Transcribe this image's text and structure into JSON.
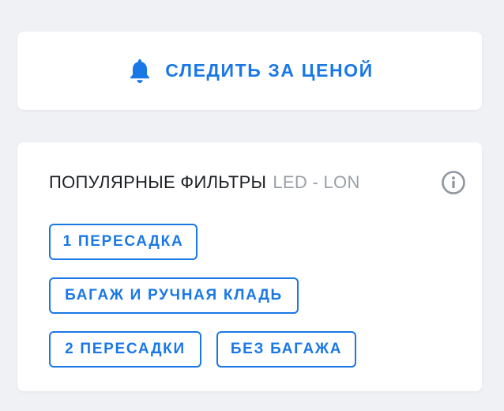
{
  "watch_price": {
    "label": "СЛЕДИТЬ ЗА ЦЕНОЙ",
    "icon": "bell-icon",
    "accent_color": "#1a78e6"
  },
  "popular_filters": {
    "title": "ПОПУЛЯРНЫЕ ФИЛЬТРЫ",
    "route": "LED - LON",
    "info_icon": "info-icon",
    "chips": [
      {
        "label": "1 ПЕРЕСАДКА"
      },
      {
        "label": "БАГАЖ И РУЧНАЯ КЛАДЬ"
      },
      {
        "label": "2 ПЕРЕСАДКИ"
      },
      {
        "label": "БЕЗ БАГАЖА"
      }
    ]
  }
}
